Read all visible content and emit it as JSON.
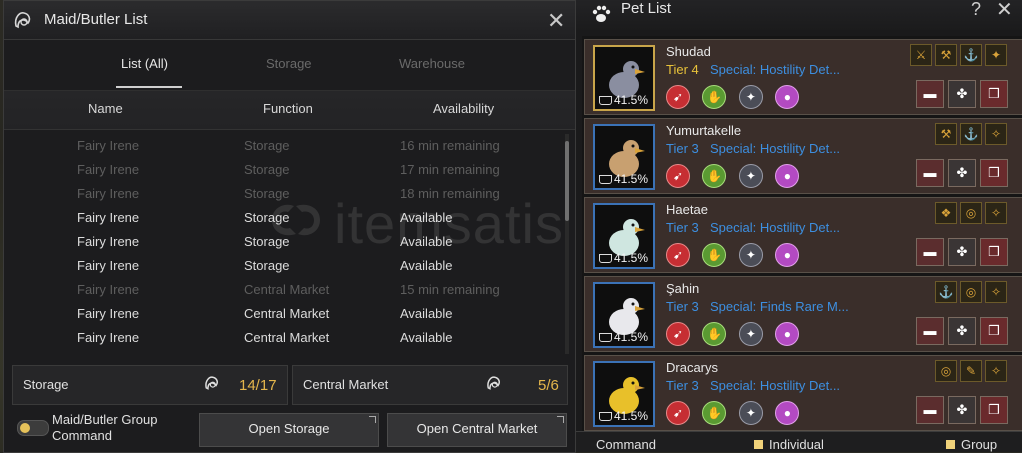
{
  "maid": {
    "title": "Maid/Butler List",
    "close_glyph": "✕",
    "tabs": [
      "List (All)",
      "Storage",
      "Warehouse"
    ],
    "headers": {
      "name": "Name",
      "function": "Function",
      "availability": "Availability"
    },
    "rows": [
      {
        "name": "Fairy Irene",
        "function": "Storage",
        "availability": "16 min remaining",
        "state": "dim"
      },
      {
        "name": "Fairy Irene",
        "function": "Storage",
        "availability": "17 min remaining",
        "state": "dim"
      },
      {
        "name": "Fairy Irene",
        "function": "Storage",
        "availability": "18 min remaining",
        "state": "dim"
      },
      {
        "name": "Fairy Irene",
        "function": "Storage",
        "availability": "Available",
        "state": "lit"
      },
      {
        "name": "Fairy Irene",
        "function": "Storage",
        "availability": "Available",
        "state": "lit"
      },
      {
        "name": "Fairy Irene",
        "function": "Storage",
        "availability": "Available",
        "state": "lit"
      },
      {
        "name": "Fairy Irene",
        "function": "Central Market",
        "availability": "15 min remaining",
        "state": "dim"
      },
      {
        "name": "Fairy Irene",
        "function": "Central Market",
        "availability": "Available",
        "state": "lit"
      },
      {
        "name": "Fairy Irene",
        "function": "Central Market",
        "availability": "Available",
        "state": "lit"
      }
    ],
    "storage_label": "Storage",
    "storage_count": "14/17",
    "market_label": "Central Market",
    "market_count": "5/6",
    "group_command_label": "Maid/Butler Group Command",
    "open_storage": "Open Storage",
    "open_market": "Open Central Market",
    "watermark": "itemsatis"
  },
  "pets": {
    "title": "Pet List",
    "help_glyph": "?",
    "close_glyph": "✕",
    "list": [
      {
        "name": "Shudad",
        "tier": "Tier 4",
        "special": "Special: Hostility Det...",
        "hunger": "41.5%",
        "frame": "gold",
        "tier_color": "#e8c23a",
        "traits": [
          "⚔",
          "⚒",
          "⚓",
          "✦"
        ],
        "pet_color": "#8a8ea0"
      },
      {
        "name": "Yumurtakelle",
        "tier": "Tier 3",
        "special": "Special: Hostility Det...",
        "hunger": "41.5%",
        "frame": "blue",
        "tier_color": "#3d8fe0",
        "traits": [
          "⚒",
          "⚓",
          "✧"
        ],
        "pet_color": "#c8a070"
      },
      {
        "name": "Haetae",
        "tier": "Tier 3",
        "special": "Special: Hostility Det...",
        "hunger": "41.5%",
        "frame": "blue",
        "tier_color": "#3d8fe0",
        "traits": [
          "❖",
          "◎",
          "✧"
        ],
        "pet_color": "#cfe6e0"
      },
      {
        "name": "Şahin",
        "tier": "Tier 3",
        "special": "Special: Finds Rare M...",
        "hunger": "41.5%",
        "frame": "blue",
        "tier_color": "#3d8fe0",
        "traits": [
          "⚓",
          "◎",
          "✧"
        ],
        "pet_color": "#e8e8ec"
      },
      {
        "name": "Dracarys",
        "tier": "Tier 3",
        "special": "Special: Hostility Det...",
        "hunger": "41.5%",
        "frame": "blue",
        "tier_color": "#3d8fe0",
        "traits": [
          "◎",
          "✎",
          "✧"
        ],
        "pet_color": "#e8c02a"
      }
    ],
    "bottom": {
      "command": "Command",
      "individual": "Individual",
      "group": "Group"
    }
  }
}
